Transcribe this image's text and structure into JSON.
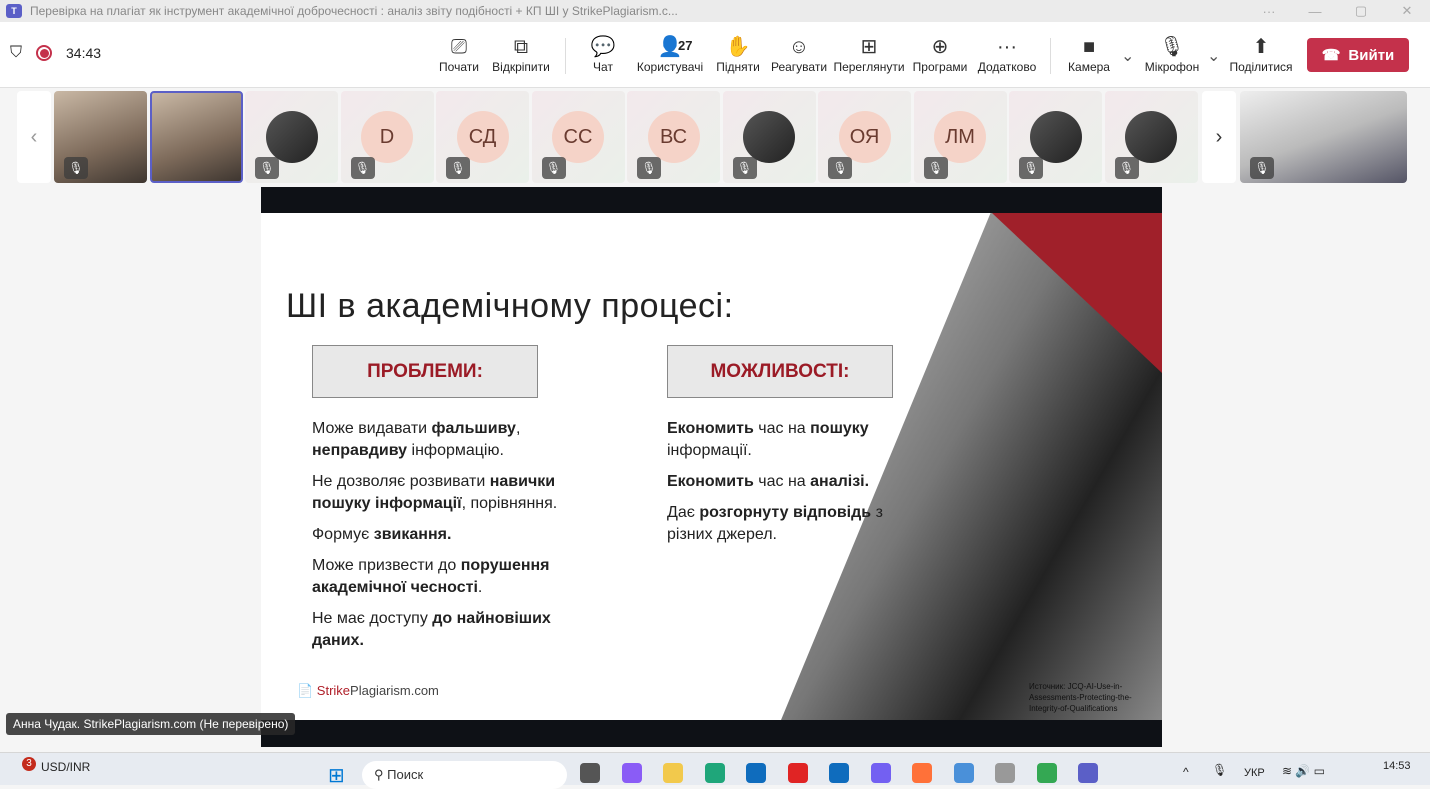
{
  "window": {
    "title": "Перевірка на плагіат як інструмент академічної доброчесності : аналіз звіту подібності + КП ШІ у StrikePlagiarism.c...",
    "controls": [
      "···",
      "—",
      "▢",
      "✕"
    ]
  },
  "meeting": {
    "timer": "34:43"
  },
  "toolbar": {
    "items": [
      {
        "label": "Почати",
        "icon": "share-screen-icon",
        "glyph": "⎚"
      },
      {
        "label": "Відкріпити",
        "icon": "pop-out-icon",
        "glyph": "⧉"
      },
      {
        "label": "Чат",
        "icon": "chat-icon",
        "glyph": "💬"
      },
      {
        "label": "Користувачі",
        "icon": "people-icon",
        "glyph": "👤",
        "badge": "27"
      },
      {
        "label": "Підняти",
        "icon": "raise-hand-icon",
        "glyph": "✋"
      },
      {
        "label": "Реагувати",
        "icon": "react-icon",
        "glyph": "☺"
      },
      {
        "label": "Переглянути",
        "icon": "view-icon",
        "glyph": "⊞"
      },
      {
        "label": "Програми",
        "icon": "apps-icon",
        "glyph": "⊕"
      },
      {
        "label": "Додатково",
        "icon": "more-icon",
        "glyph": "···"
      },
      {
        "label": "Камера",
        "icon": "camera-icon",
        "glyph": "■"
      },
      {
        "label": "Мікрофон",
        "icon": "mic-off-icon",
        "glyph": "🎙"
      },
      {
        "label": "Поділитися",
        "icon": "share-icon",
        "glyph": "⬆"
      }
    ],
    "leave": "Вийти",
    "leave_color": "#c4314b"
  },
  "participants": [
    {
      "type": "photo"
    },
    {
      "type": "photo",
      "selected": true
    },
    {
      "type": "photo-avatar"
    },
    {
      "initials": "D"
    },
    {
      "initials": "СД"
    },
    {
      "initials": "СС"
    },
    {
      "initials": "ВС"
    },
    {
      "type": "photo-avatar"
    },
    {
      "initials": "ОЯ"
    },
    {
      "initials": "ЛМ"
    },
    {
      "type": "photo-avatar"
    },
    {
      "type": "photo-avatar"
    }
  ],
  "slide": {
    "title": "ШІ в академічному процесі:",
    "left_header": "ПРОБЛЕМИ:",
    "right_header": "МОЖЛИВОСТІ:",
    "left": [
      [
        {
          "t": "Може видавати "
        },
        {
          "t": "фальшиву",
          "b": 1
        },
        {
          "t": ", "
        },
        {
          "t": "неправдиву",
          "b": 1
        },
        {
          "t": " інформацію."
        }
      ],
      [
        {
          "t": "Не дозволяє розвивати "
        },
        {
          "t": "навички пошуку інформації",
          "b": 1
        },
        {
          "t": ", порівняння."
        }
      ],
      [
        {
          "t": "Формує "
        },
        {
          "t": "звикання.",
          "b": 1
        }
      ],
      [
        {
          "t": "Може призвести до "
        },
        {
          "t": "порушення академічної чесності",
          "b": 1
        },
        {
          "t": "."
        }
      ],
      [
        {
          "t": "Не має доступу "
        },
        {
          "t": "до найновіших даних.",
          "b": 1
        }
      ]
    ],
    "right": [
      [
        {
          "t": "Економить",
          "b": 1
        },
        {
          "t": " час на "
        },
        {
          "t": "пошуку",
          "b": 1
        },
        {
          "t": " інформації."
        }
      ],
      [
        {
          "t": "Економить",
          "b": 1
        },
        {
          "t": " час на "
        },
        {
          "t": "аналізі.",
          "b": 1
        }
      ],
      [
        {
          "t": "Дає "
        },
        {
          "t": "розгорнуту відповідь",
          "b": 1
        },
        {
          "t": " з різних джерел."
        }
      ]
    ],
    "source": "Источник: JCQ-AI-Use-in-Assessments-Protecting-the-Integrity-of-Qualifications",
    "logo": "StrikePlagiarism.com",
    "accent": "#a0202a"
  },
  "presenter_caption": "Анна Чудак. StrikePlagiarism.com (Не перевірено)",
  "taskbar": {
    "widget": "USD/INR",
    "widget_badge": "3",
    "search": "Поиск",
    "lang": "УКР",
    "time": "14:53"
  }
}
